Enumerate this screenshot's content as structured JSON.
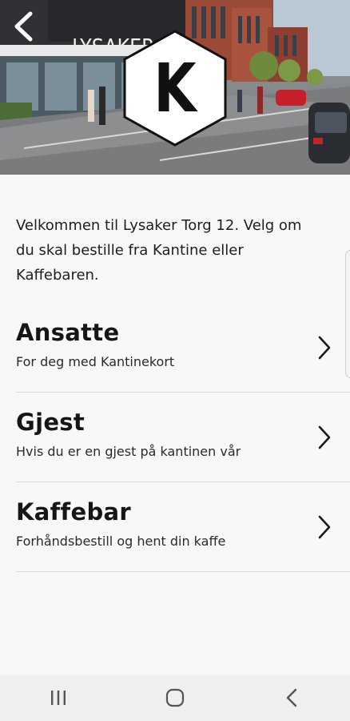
{
  "hero": {
    "building_sign": "LYSAKER",
    "logo_letter": "K"
  },
  "intro": {
    "text": "Velkommen til Lysaker Torg 12. Velg om du skal bestille fra Kantine eller Kaffebaren."
  },
  "menu": {
    "items": [
      {
        "title": "Ansatte",
        "subtitle": "For deg med Kantinekort"
      },
      {
        "title": "Gjest",
        "subtitle": "Hvis du er en gjest på kantinen vår"
      },
      {
        "title": "Kaffebar",
        "subtitle": "Forhåndsbestill og hent din kaffe"
      }
    ]
  },
  "icons": {
    "back": "chevron-left-icon",
    "menu_arrow": "chevron-right-icon",
    "nav_recents": "recents-icon",
    "nav_home": "home-icon",
    "nav_back": "nav-back-icon"
  },
  "colors": {
    "background": "#f8f8f8",
    "text": "#1a1a1a",
    "divider": "#dcdcdc",
    "navbar": "#efefef"
  }
}
